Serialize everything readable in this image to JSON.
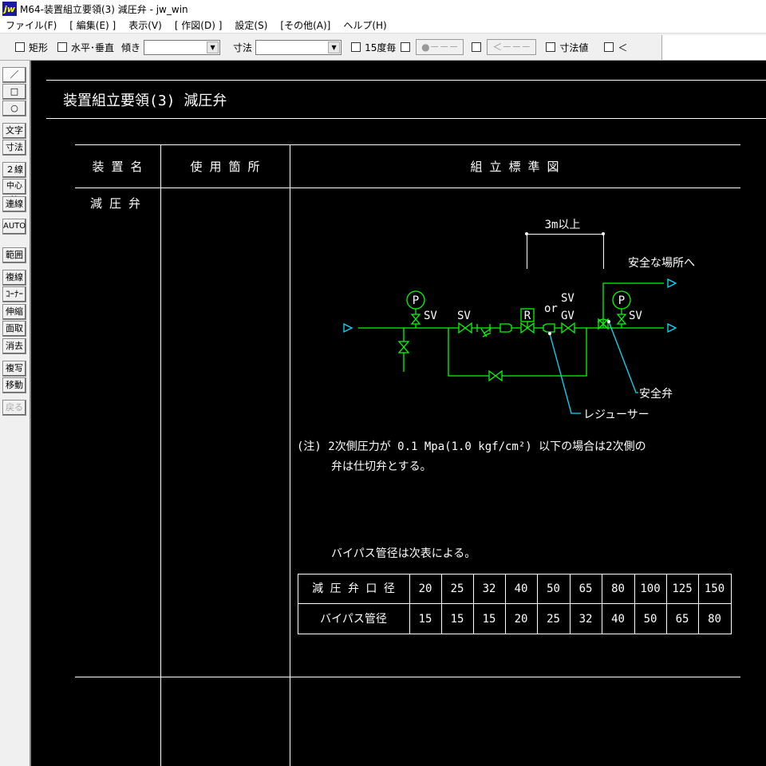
{
  "window": {
    "title": "M64-装置組立要領(3) 減圧弁 - jw_win",
    "logo": "jw"
  },
  "menu": [
    "ファイル(F)",
    "[ 編集(E) ]",
    "表示(V)",
    "[ 作図(D) ]",
    "設定(S)",
    "[その他(A)]",
    "ヘルプ(H)"
  ],
  "toolbar": {
    "rect": "矩形",
    "hv": "水平･垂直",
    "tilt": "傾き",
    "tilt_value": "",
    "dim": "寸法",
    "dim_value": "",
    "deg15": "15度毎",
    "btn1": "●－－－",
    "btn2": "＜－－－",
    "dimval": "寸法値",
    "lt": "＜"
  },
  "tools": [
    "／",
    "□",
    "○",
    "文字",
    "寸法",
    "２線",
    "中心線",
    "連線",
    "AUTO",
    "範囲",
    "複線",
    "ｺｰﾅｰ",
    "伸縮",
    "面取",
    "消去",
    "複写",
    "移動",
    "戻る"
  ],
  "drawing": {
    "title": "装置組立要領(3) 減圧弁",
    "headers": [
      "装 置 名",
      "使 用 箇 所",
      "組  立  標  準  図"
    ],
    "device_name": "減 圧 弁",
    "labels": {
      "dim": "3m以上",
      "safe_place": "安全な場所へ",
      "p1": "P",
      "p2": "P",
      "sv1": "SV",
      "sv2": "SV",
      "sv3": "SV",
      "sv4": "SV",
      "or": "or",
      "gv": "GV",
      "r": "R",
      "safety_valve": "安全弁",
      "reducer": "レジューサー"
    },
    "note1": "(注) 2次側圧力が 0.1 Mpa(1.0 kgf/cm²) 以下の場合は2次側の",
    "note2": "弁は仕切弁とする。",
    "bypass_note": "バイパス管径は次表による。",
    "table": {
      "row1_label": "減 圧 弁 口 径",
      "row1": [
        "20",
        "25",
        "32",
        "40",
        "50",
        "65",
        "80",
        "100",
        "125",
        "150"
      ],
      "row2_label": "バイパス管径",
      "row2": [
        "15",
        "15",
        "15",
        "20",
        "25",
        "32",
        "40",
        "50",
        "65",
        "80"
      ]
    }
  },
  "colors": {
    "pipe": "#00ff00",
    "leader": "#00e0ff",
    "line": "#ffffff"
  }
}
